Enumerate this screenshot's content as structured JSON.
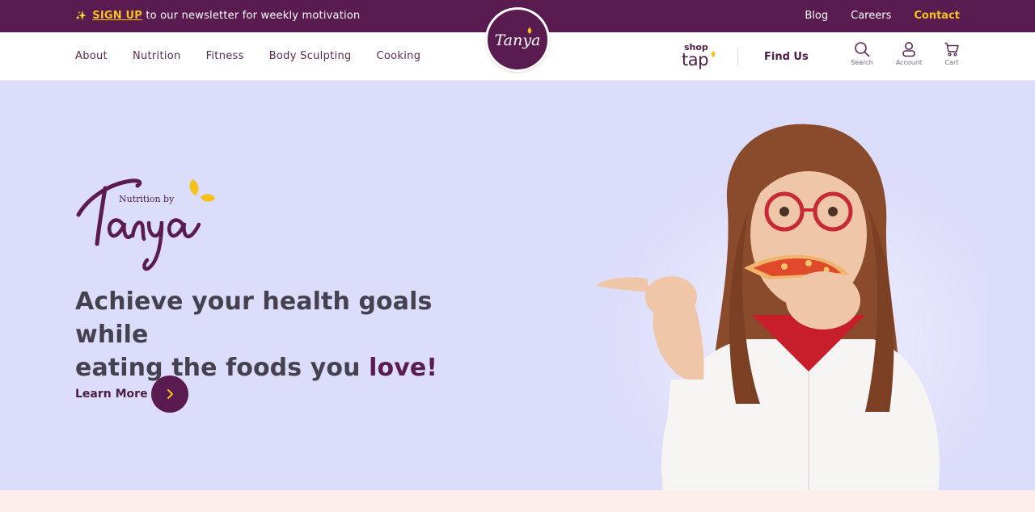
{
  "topbar": {
    "sparkle": "✨",
    "signup_label": "SIGN UP",
    "promo_text": " to our newsletter for weekly motivation",
    "links": [
      "Blog",
      "Careers",
      "Contact"
    ]
  },
  "nav": {
    "items": [
      "About",
      "Nutrition",
      "Fitness",
      "Body Sculpting",
      "Cooking"
    ],
    "logo_text": "Tanya",
    "shop_small": "shop",
    "shop_big": "tap",
    "find_us": "Find Us",
    "icons": [
      {
        "name": "search-icon",
        "label": "Search"
      },
      {
        "name": "account-icon",
        "label": "Account"
      },
      {
        "name": "cart-icon",
        "label": "Cart"
      }
    ]
  },
  "hero": {
    "brand_small": "Nutrition by",
    "brand_script": "Tanya",
    "headline_line1": "Achieve your health goals while",
    "headline_line2": "eating the foods you ",
    "headline_emphasis": "love!",
    "cta_label": "Learn More"
  },
  "colors": {
    "brand_purple": "#5a1c50",
    "accent_yellow": "#f5c21b",
    "hero_background": "#dcdcfb",
    "footer_strip": "#fdeee9"
  }
}
